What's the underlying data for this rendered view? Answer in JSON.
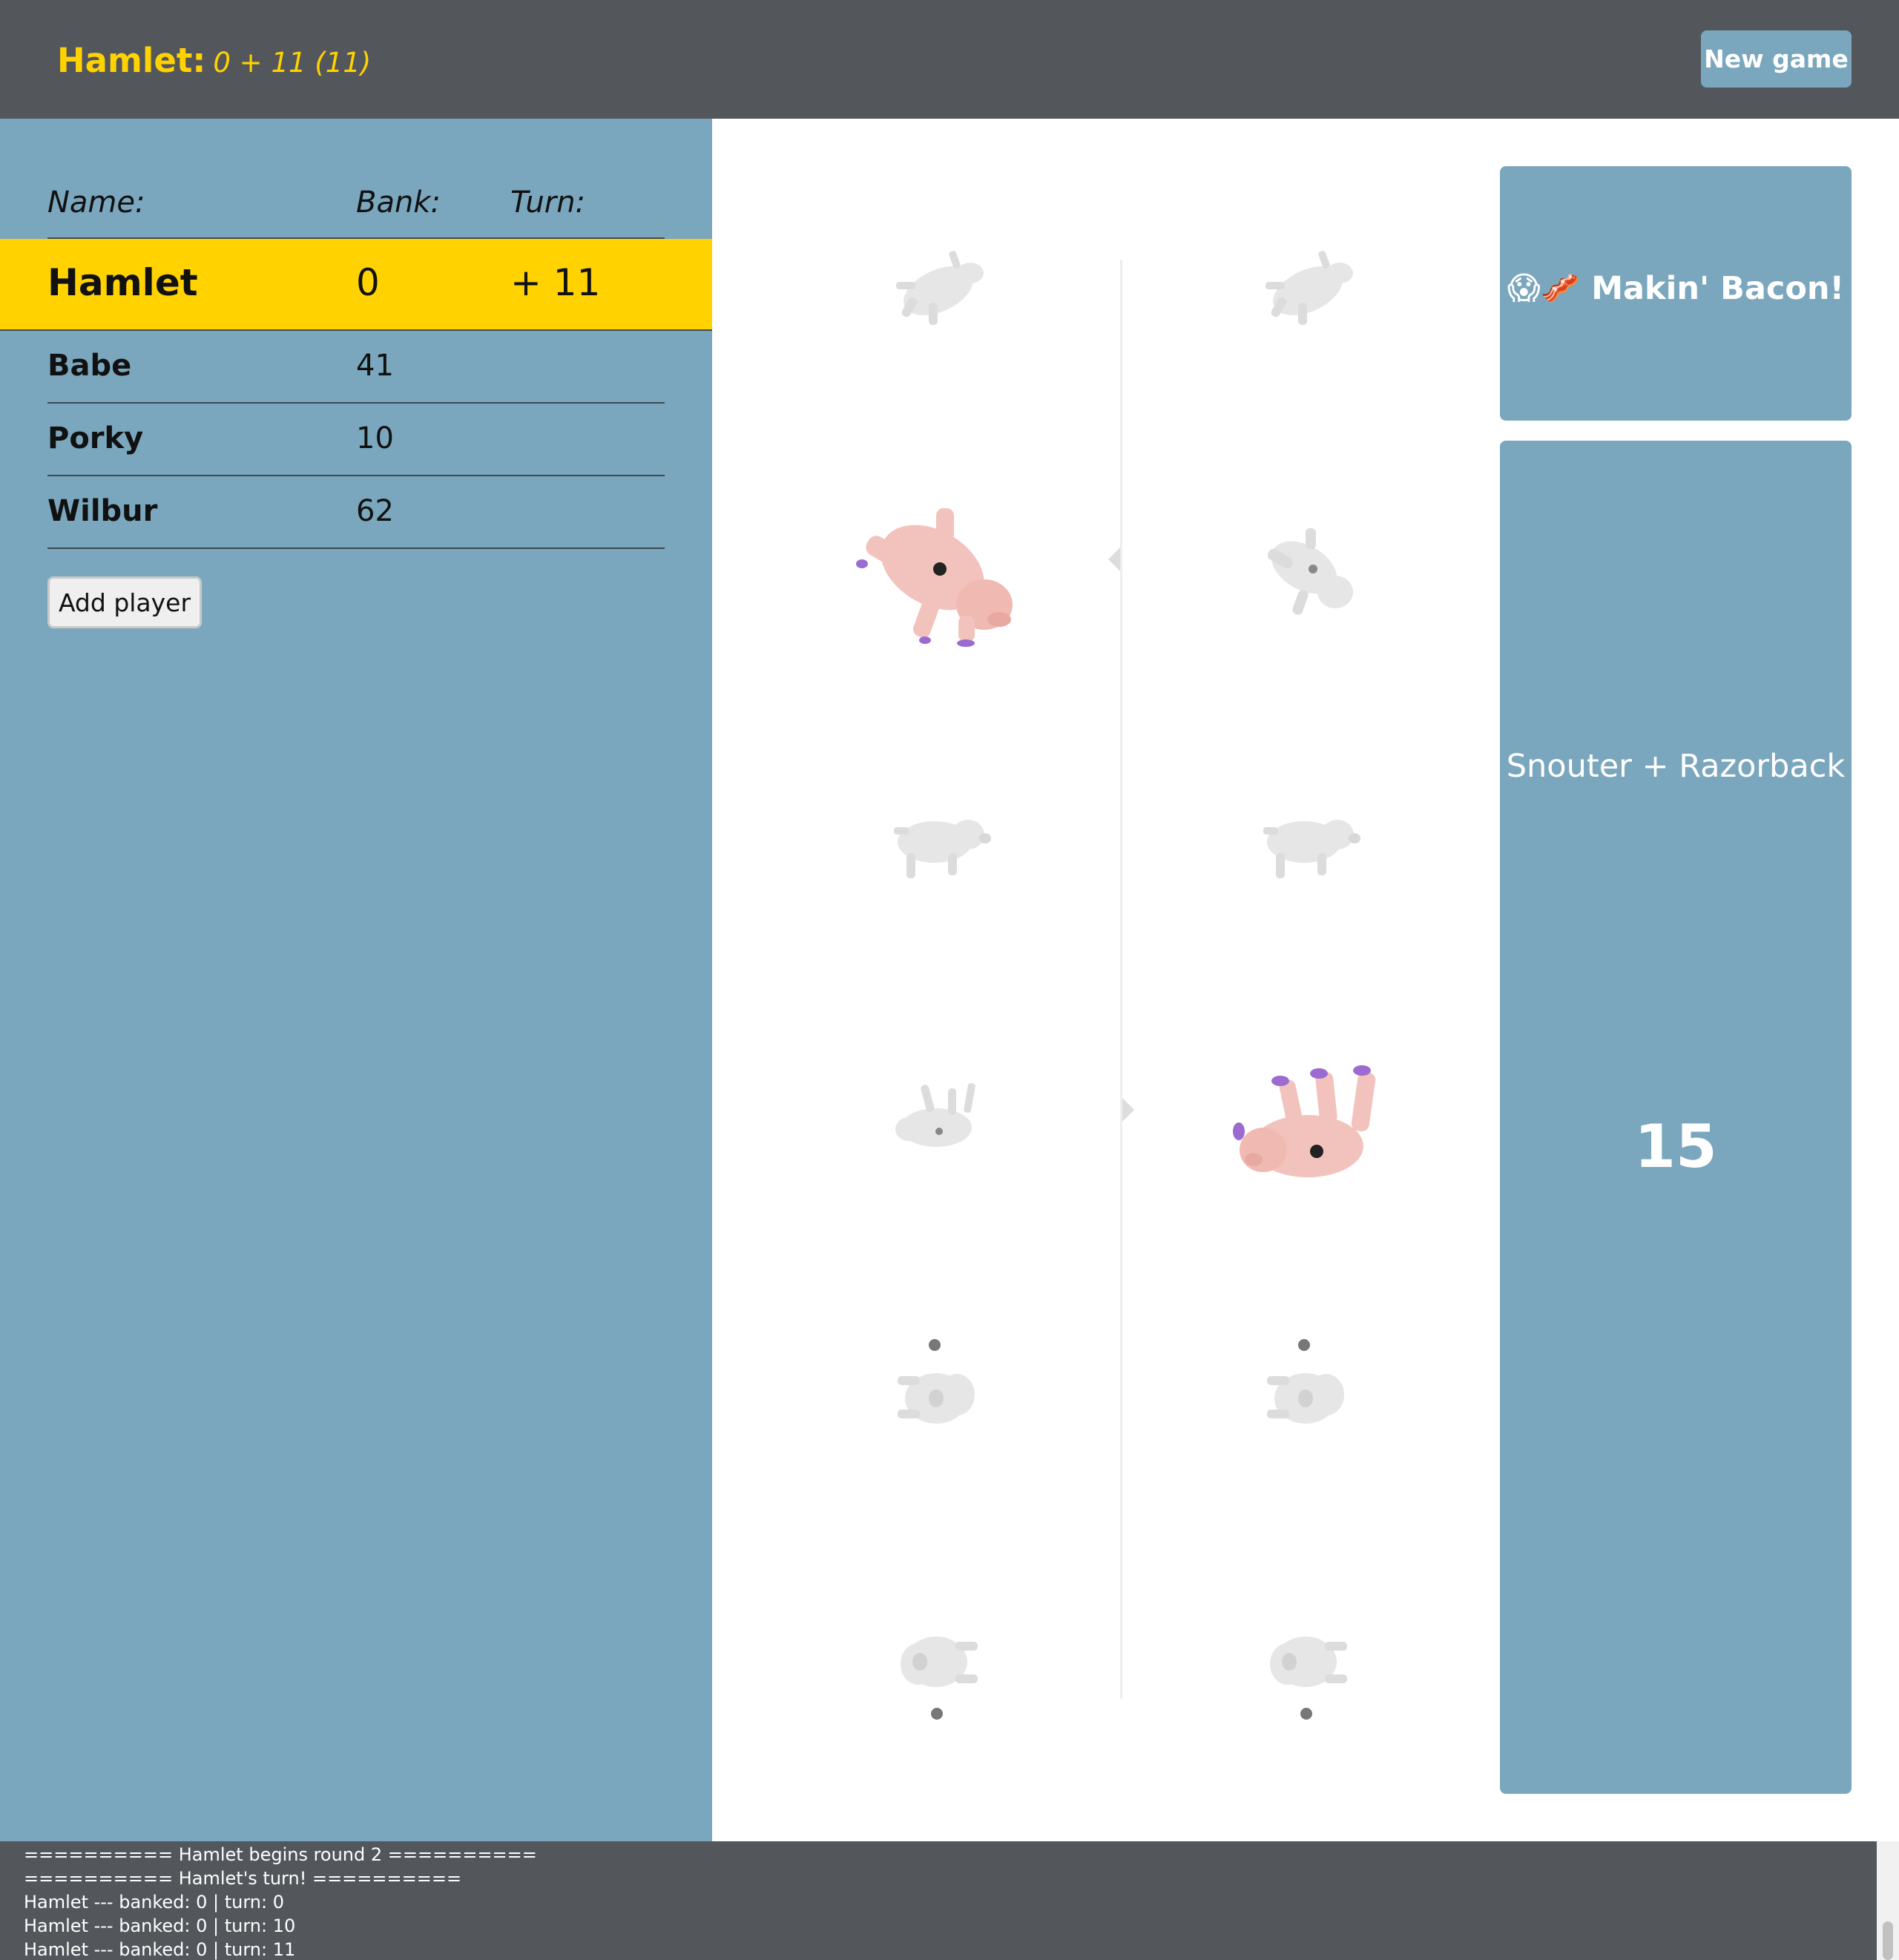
{
  "header": {
    "current_player": "Hamlet:",
    "score_summary": "0 + 11 (11)",
    "new_game_label": "New game"
  },
  "players_table": {
    "headers": {
      "name": "Name:",
      "bank": "Bank:",
      "turn": "Turn:"
    },
    "rows": [
      {
        "name": "Hamlet",
        "bank": "0",
        "turn": "+ 11",
        "active": true
      },
      {
        "name": "Babe",
        "bank": "41",
        "turn": "",
        "active": false
      },
      {
        "name": "Porky",
        "bank": "10",
        "turn": "",
        "active": false
      },
      {
        "name": "Wilbur",
        "bank": "62",
        "turn": "",
        "active": false
      }
    ],
    "add_player_label": "Add player"
  },
  "pig_board": {
    "left_column": [
      {
        "position": "Razorback",
        "selected": false
      },
      {
        "position": "Snouter",
        "selected": true
      },
      {
        "position": "Trotter",
        "selected": false
      },
      {
        "position": "Razorback",
        "selected": false
      },
      {
        "position": "Sider (dot up)",
        "selected": false
      },
      {
        "position": "Sider (dot down)",
        "selected": false
      }
    ],
    "right_column": [
      {
        "position": "Razorback",
        "selected": false
      },
      {
        "position": "Snouter",
        "selected": false
      },
      {
        "position": "Trotter",
        "selected": false
      },
      {
        "position": "Razorback",
        "selected": true
      },
      {
        "position": "Sider (dot up)",
        "selected": false
      },
      {
        "position": "Sider (dot down)",
        "selected": false
      }
    ],
    "colors": {
      "selected_pig": "#f2c3bd",
      "unselected_pig": "#e6e6e6",
      "hooves": "#9b6bd0"
    }
  },
  "result": {
    "title": "😱🥓 Makin' Bacon!",
    "roll_name": "Snouter + Razorback",
    "points": "15"
  },
  "log": [
    "========== Hamlet begins round 2 ==========",
    "========== Hamlet's turn! ==========",
    "Hamlet --- banked: 0 | turn: 0",
    "Hamlet --- banked: 0 | turn: 10",
    "Hamlet --- banked: 0 | turn: 11"
  ],
  "colors": {
    "header_bg": "#53575c",
    "accent_yellow": "#ffd200",
    "panel_blue": "#7aa7bd"
  }
}
